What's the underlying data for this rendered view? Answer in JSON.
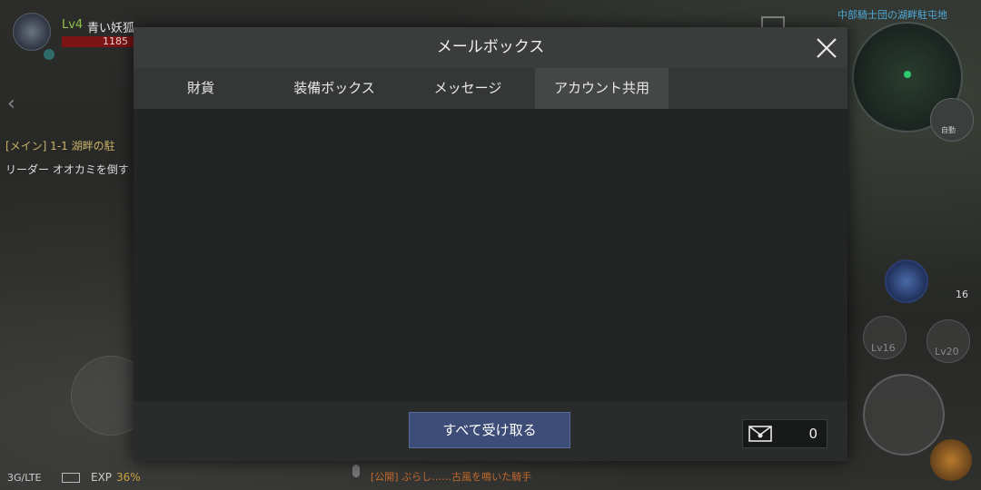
{
  "hud": {
    "level": "Lv4",
    "player_name": "青い妖狐",
    "hp_value": "1185",
    "quest_title": "[メイン] 1-1 湖畔の駐",
    "quest_desc": "リーダー オオカミを倒す",
    "zone_name": "中部騎士団の湖畔駐屯地",
    "auto_label": "自動",
    "skill_lv16": "Lv16",
    "skill_lv20": "Lv20",
    "potion_count": "16",
    "network": "3G/LTE",
    "exp_label": "EXP",
    "exp_value": "36%",
    "chat_text": "[公開] ぶらし……古風を鳴いた騎手"
  },
  "dialog": {
    "title": "メールボックス",
    "tabs": [
      {
        "label": "財貨",
        "active": false
      },
      {
        "label": "装備ボックス",
        "active": false
      },
      {
        "label": "メッセージ",
        "active": false
      },
      {
        "label": "アカウント共用",
        "active": true
      }
    ],
    "claim_all_label": "すべて受け取る",
    "mail_count": "0"
  },
  "colors": {
    "accent_button": "#3e4c78",
    "active_tab": "#454747",
    "hp_bar": "#7b1414",
    "quest_title": "#c9b36a",
    "zone_text": "#4fa8d8"
  },
  "icons": [
    "close-icon",
    "mail-icon",
    "shield-icon",
    "mic-icon",
    "battery-icon"
  ]
}
